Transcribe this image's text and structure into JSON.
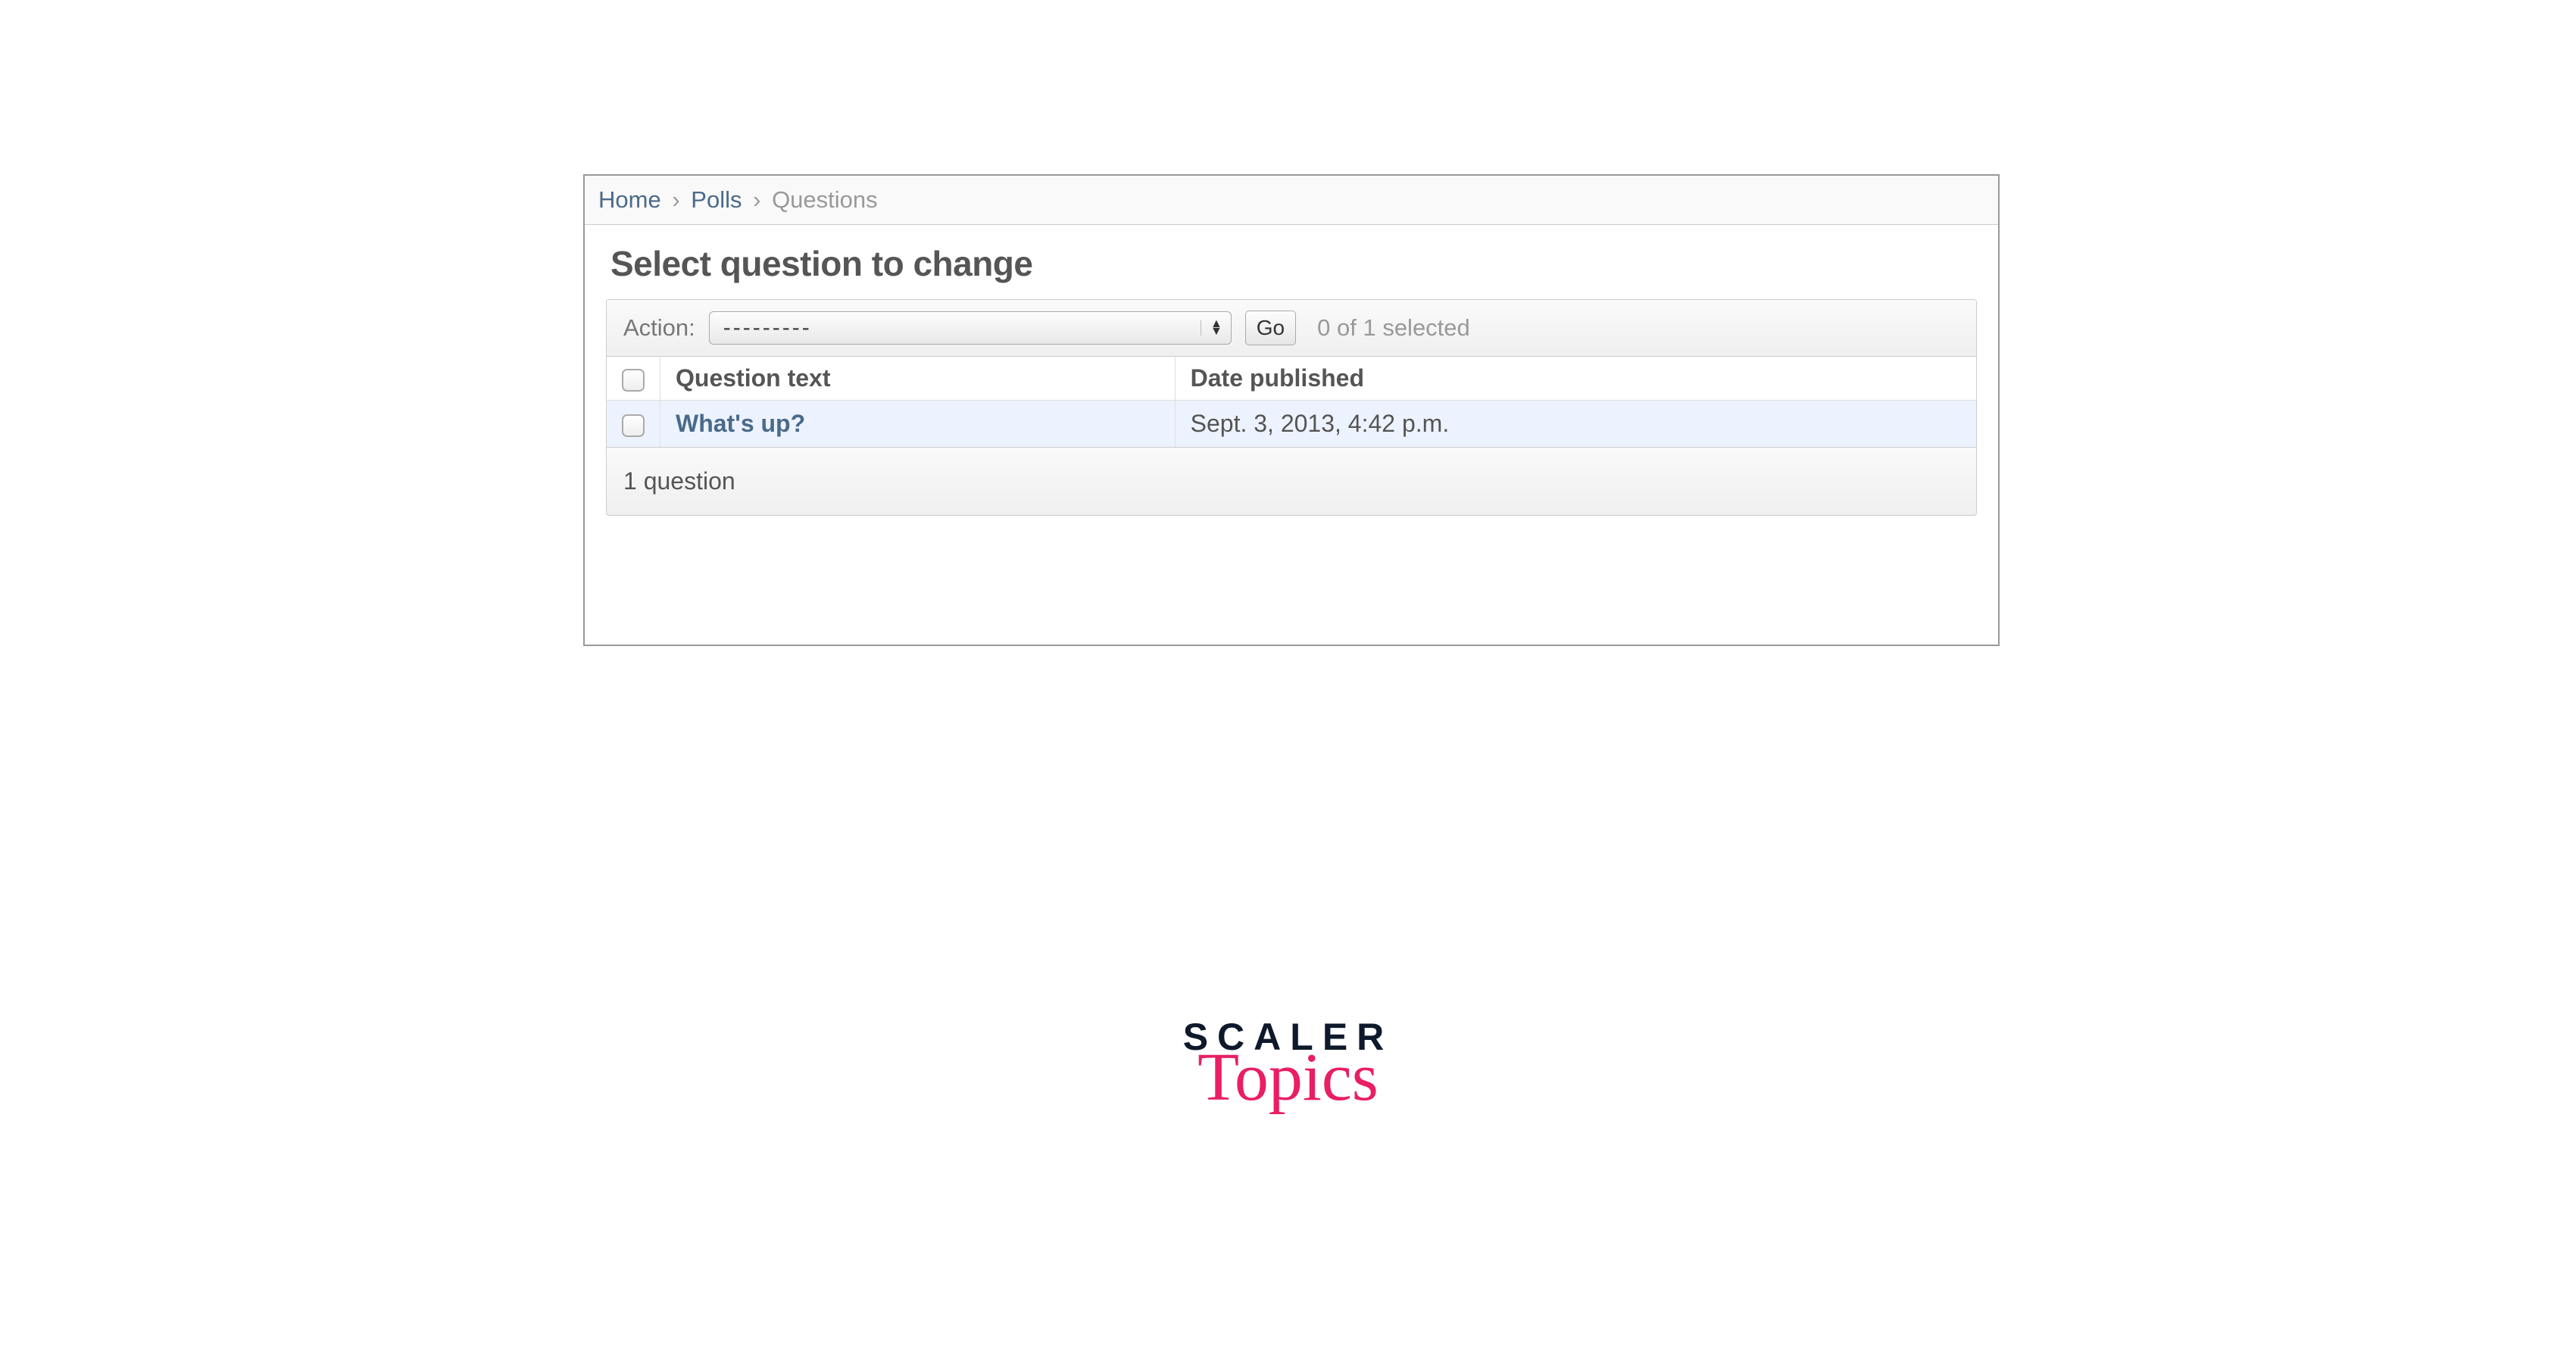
{
  "breadcrumb": {
    "home": "Home",
    "polls": "Polls",
    "current": "Questions"
  },
  "page_title": "Select question to change",
  "actions": {
    "label": "Action:",
    "selected_option": "---------",
    "go_label": "Go",
    "selection_count": "0 of 1 selected"
  },
  "table": {
    "headers": {
      "question_text": "Question text",
      "date_published": "Date published"
    },
    "rows": [
      {
        "question_text": "What's up?",
        "date_published": "Sept. 3, 2013, 4:42 p.m."
      }
    ]
  },
  "footer": {
    "count": "1 question"
  },
  "brand": {
    "line1": "SCALER",
    "line2": "Topics"
  }
}
